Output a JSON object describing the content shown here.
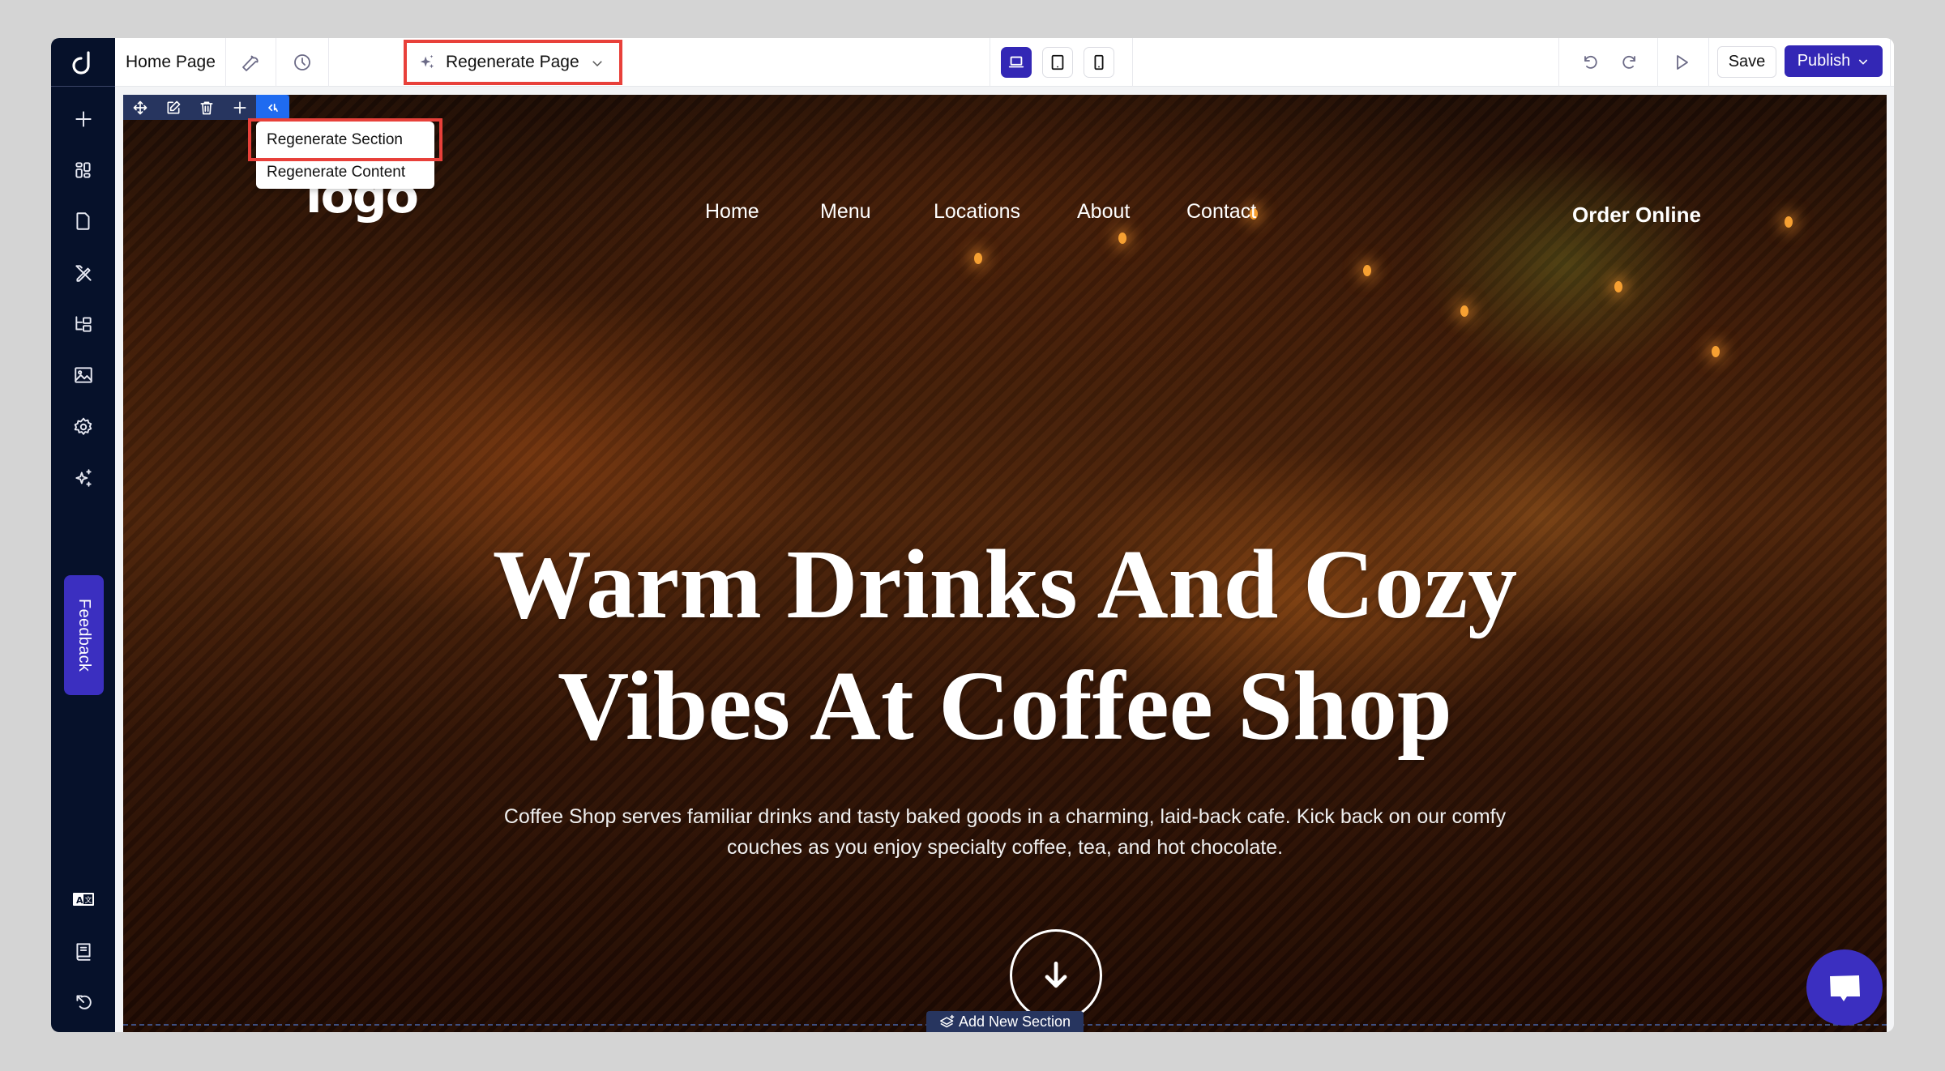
{
  "topbar": {
    "page_name": "Home Page",
    "regenerate_label": "Regenerate Page",
    "devices": [
      {
        "name": "desktop",
        "active": true
      },
      {
        "name": "tablet",
        "active": false
      },
      {
        "name": "mobile",
        "active": false
      }
    ],
    "save_label": "Save",
    "publish_label": "Publish"
  },
  "sidebar": {
    "items": [
      "add",
      "sections",
      "pages",
      "design",
      "sitemap",
      "media",
      "settings",
      "ai-tools"
    ],
    "feedback_label": "Feedback",
    "bottom_items": [
      "language",
      "guides",
      "history"
    ]
  },
  "section_toolbar": {
    "items": [
      "move",
      "edit",
      "delete",
      "add",
      "regenerate"
    ],
    "dropdown": [
      "Regenerate Section",
      "Regenerate Content"
    ]
  },
  "site": {
    "logo_text": "logo",
    "nav": [
      "Home",
      "Menu",
      "Locations",
      "About",
      "Contact"
    ],
    "cta": "Order Online",
    "headline_line1": "Warm Drinks And Cozy",
    "headline_line2": "Vibes At Coffee Shop",
    "subtext": "Coffee Shop serves familiar drinks and tasty baked goods in a charming, laid-back cafe. Kick back on our comfy couches as you enjoy specialty coffee, tea, and hot chocolate."
  },
  "add_section_label": "Add New Section",
  "colors": {
    "accent": "#3327b5",
    "sidebar_bg": "#06112a",
    "highlight": "#e8403a",
    "toolbar_bg": "#27355f",
    "active_tool": "#1f6bf0"
  }
}
